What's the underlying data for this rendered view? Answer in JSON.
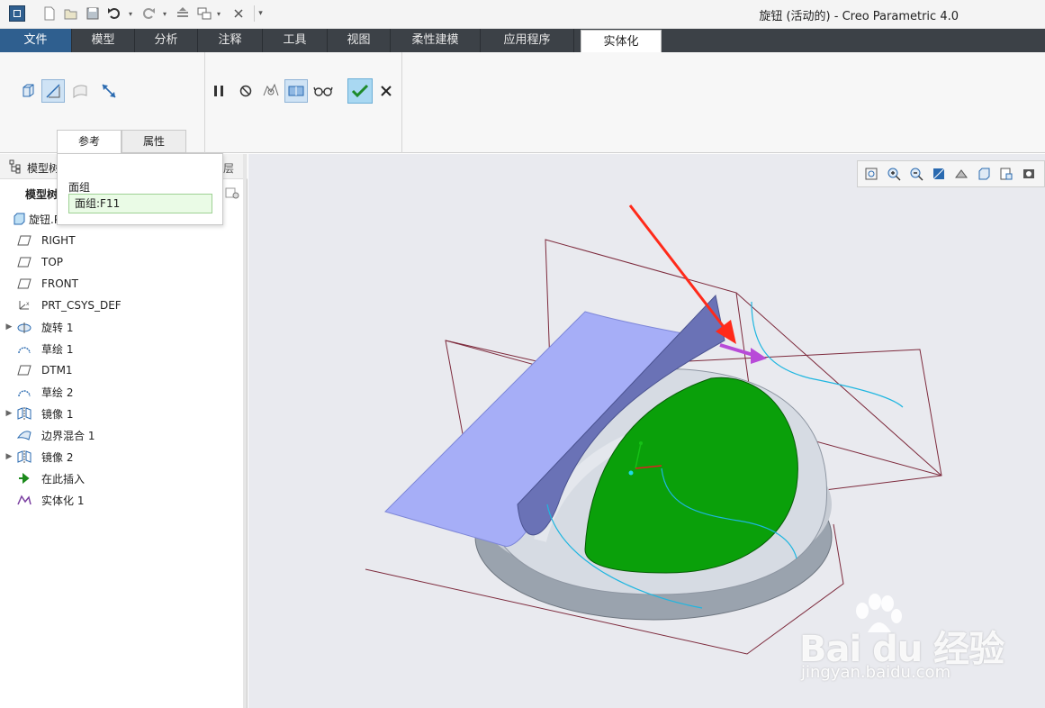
{
  "window": {
    "title": "旋钮 (活动的) - Creo Parametric 4.0"
  },
  "quick_access": {
    "icons": [
      "app-menu-icon",
      "new-icon",
      "open-icon",
      "save-icon",
      "undo-icon",
      "redo-icon",
      "regenerate-icon",
      "windows-icon",
      "close-window-icon",
      "customize-icon"
    ]
  },
  "tabs": [
    {
      "label": "文件"
    },
    {
      "label": "模型"
    },
    {
      "label": "分析"
    },
    {
      "label": "注释"
    },
    {
      "label": "工具"
    },
    {
      "label": "视图"
    },
    {
      "label": "柔性建模"
    },
    {
      "label": "应用程序"
    },
    {
      "label": "实体化"
    }
  ],
  "ribbon": {
    "dashboard_tabs": [
      {
        "label": "参考"
      },
      {
        "label": "属性"
      }
    ]
  },
  "ref_panel": {
    "title": "面组",
    "field_value": "面组:F11"
  },
  "model_tree": {
    "header": "模型树",
    "header_right": "层",
    "sub_header": "模型树",
    "root": "旋钮.PRT",
    "items": [
      {
        "label": "RIGHT",
        "icon": "datum-plane-icon",
        "expandable": false
      },
      {
        "label": "TOP",
        "icon": "datum-plane-icon",
        "expandable": false
      },
      {
        "label": "FRONT",
        "icon": "datum-plane-icon",
        "expandable": false
      },
      {
        "label": "PRT_CSYS_DEF",
        "icon": "csys-icon",
        "expandable": false
      },
      {
        "label": "旋转 1",
        "icon": "revolve-icon",
        "expandable": true
      },
      {
        "label": "草绘 1",
        "icon": "sketch-icon",
        "expandable": false
      },
      {
        "label": "DTM1",
        "icon": "datum-plane-icon",
        "expandable": false
      },
      {
        "label": "草绘 2",
        "icon": "sketch-icon",
        "expandable": false
      },
      {
        "label": "镜像 1",
        "icon": "mirror-icon",
        "expandable": true
      },
      {
        "label": "边界混合 1",
        "icon": "boundary-blend-icon",
        "expandable": false
      },
      {
        "label": "镜像 2",
        "icon": "mirror-icon",
        "expandable": true
      },
      {
        "label": "在此插入",
        "icon": "insert-here-icon",
        "expandable": false
      },
      {
        "label": "实体化 1",
        "icon": "solidify-icon",
        "expandable": false
      }
    ]
  },
  "watermark": {
    "brand": "Bai du 经验",
    "url": "jingyan.baidu.com"
  },
  "colors": {
    "tabbar": "#3c4147",
    "file_tab": "#2f5f8f",
    "quilt_blue": "#a6aef7",
    "green_surface": "#0aa00a",
    "datum_lines": "#7d2a3c",
    "arrow": "#ff2a1a",
    "direction_arrow": "#b84bd8"
  }
}
